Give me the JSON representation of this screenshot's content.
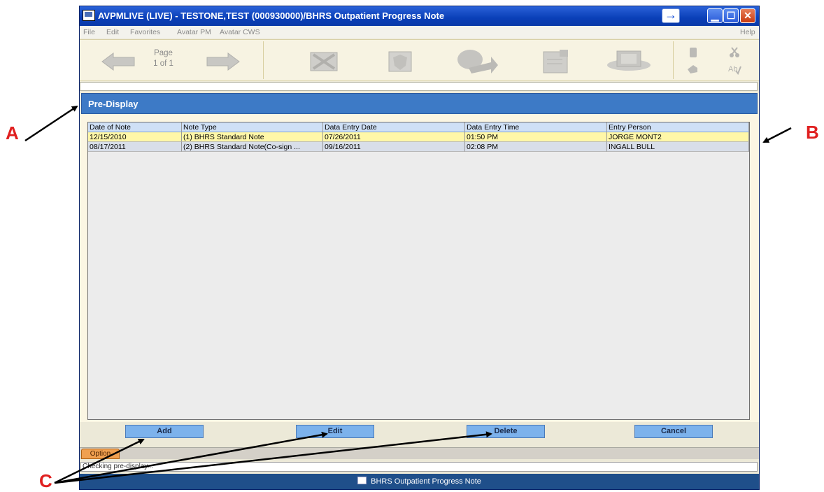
{
  "window": {
    "title": "AVPMLIVE (LIVE) - TESTONE,TEST (000930000)/BHRS Outpatient Progress Note",
    "arrow_glyph": "→",
    "min_glyph": "▁",
    "max_glyph": "☐",
    "close_glyph": "✕"
  },
  "menu": {
    "file": "File",
    "edit": "Edit",
    "favorites": "Favorites",
    "avatar_pm": "Avatar PM",
    "avatar_cws": "Avatar CWS",
    "help": "Help"
  },
  "toolbar": {
    "page_label": "Page",
    "page_count": "1 of 1"
  },
  "panel": {
    "title": "Pre-Display"
  },
  "grid": {
    "columns": [
      "Date of Note",
      "Note Type",
      "Data Entry Date",
      "Data Entry Time",
      "Entry Person"
    ],
    "rows": [
      [
        "12/15/2010",
        "(1) BHRS Standard Note",
        "07/26/2011",
        "01:50 PM",
        "JORGE MONT2"
      ],
      [
        "08/17/2011",
        "(2) BHRS Standard Note(Co-sign ...",
        "09/16/2011",
        "02:08 PM",
        "INGALL BULL"
      ]
    ]
  },
  "buttons": {
    "add": "Add",
    "edit": "Edit",
    "delete": "Delete",
    "cancel": "Cancel"
  },
  "option_tab": "Option",
  "status_text": "Checking pre-display...",
  "taskbar_text": "BHRS Outpatient Progress Note",
  "annotations": {
    "a": "A",
    "b": "B",
    "c": "C"
  },
  "colors": {
    "annotation": "#e02020",
    "panel_header": "#3d7ac6",
    "selected_row": "#fff7a8"
  }
}
